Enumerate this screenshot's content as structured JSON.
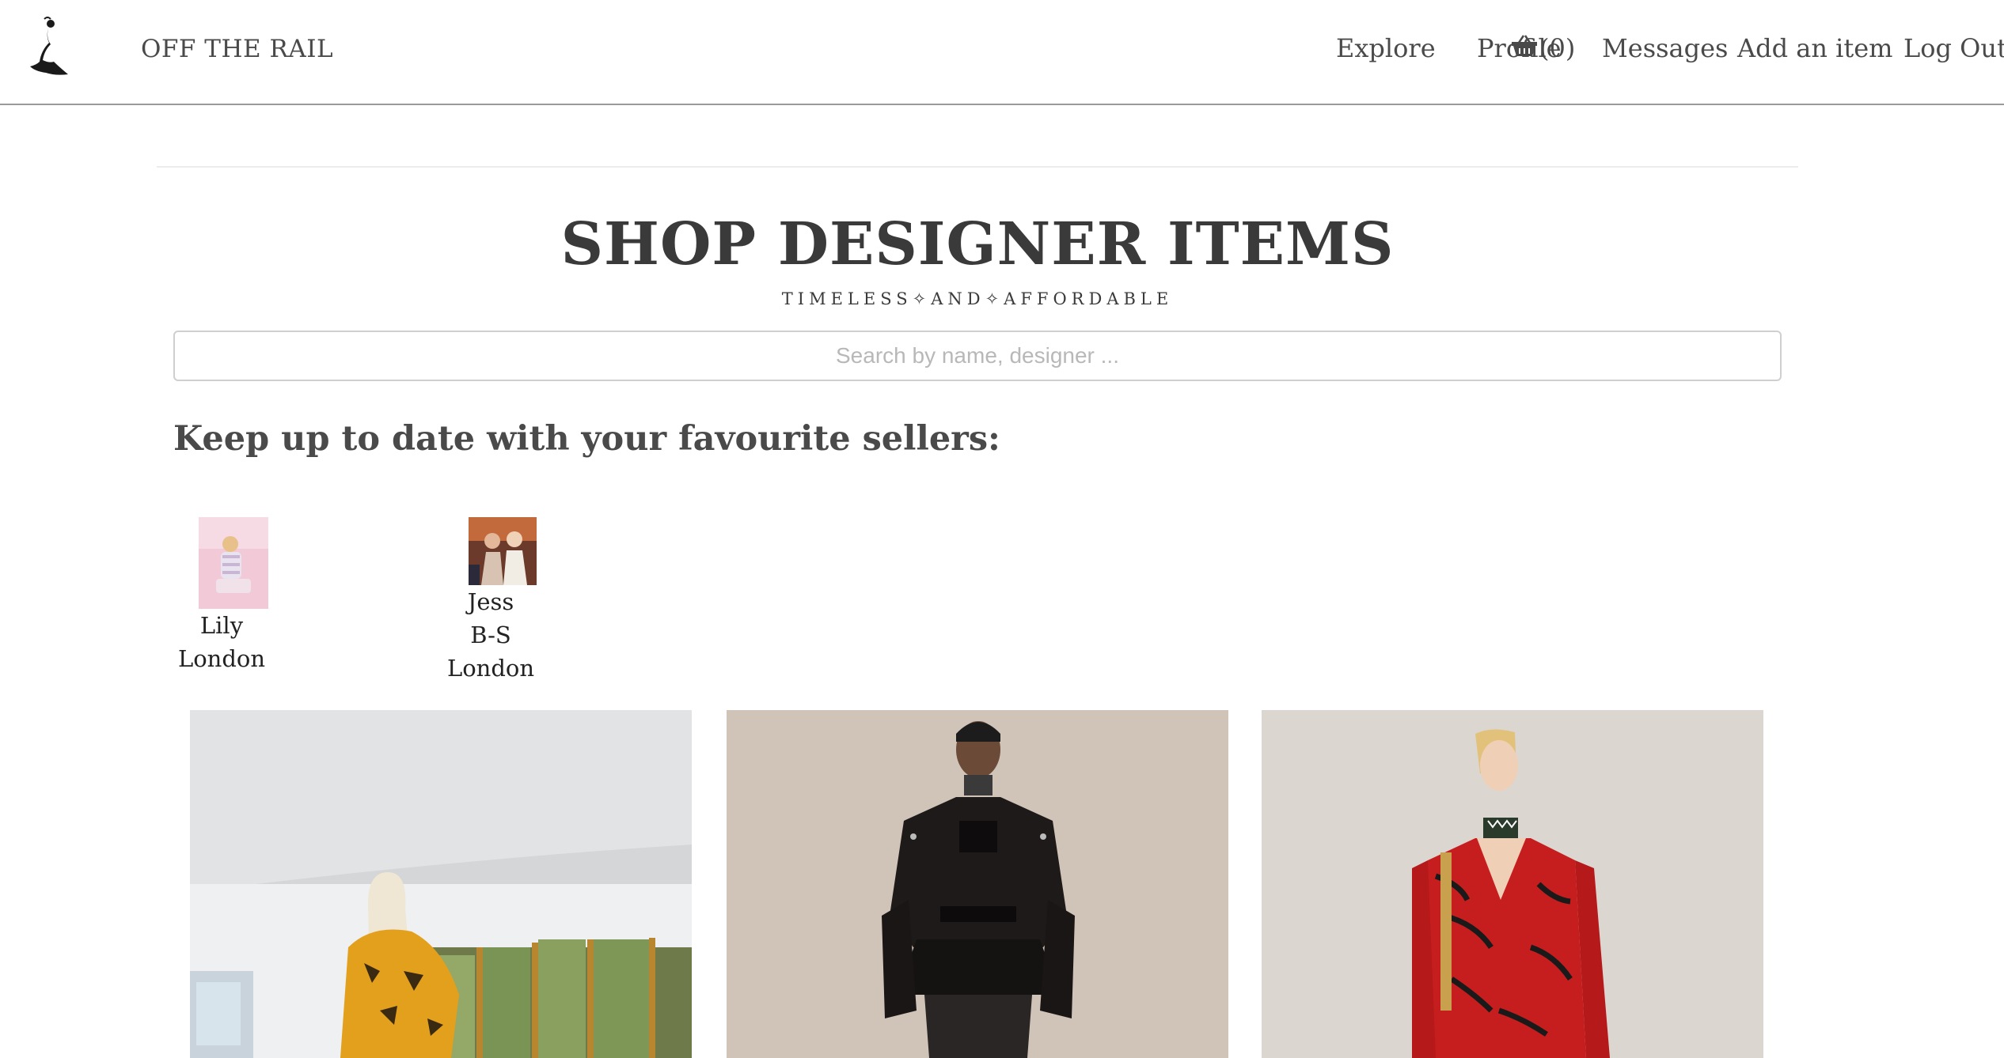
{
  "header": {
    "brand": "OFF THE RAIL",
    "nav": {
      "explore": "Explore",
      "profile": "Profile",
      "basket_count": "(0)",
      "messages": "Messages",
      "add_item": "Add an item",
      "logout": "Log Out"
    }
  },
  "hero": {
    "title": "SHOP DESIGNER ITEMS",
    "subtitle": "TIMELESS✧AND✧AFFORDABLE"
  },
  "search": {
    "placeholder": "Search by name, designer ..."
  },
  "sellers": {
    "heading": "Keep up to date with your favourite sellers:",
    "items": [
      {
        "name": "Lily",
        "location": "London"
      },
      {
        "name_line1": "Jess",
        "name_line2": "B-S",
        "location": "London"
      }
    ]
  },
  "icons": {
    "logo": "dancing-woman-logo",
    "basket": "basket-icon"
  }
}
